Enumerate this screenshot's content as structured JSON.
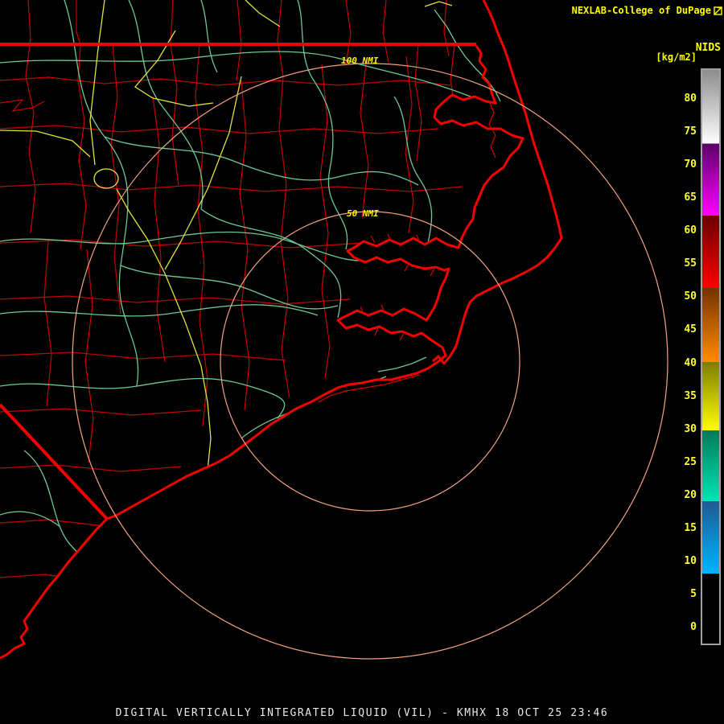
{
  "header": {
    "title": "NEXLAB-College of DuPage",
    "product_label": "NIDS",
    "units_label": "[kg/m2]"
  },
  "colorbar": {
    "border_color": "#a0a0a0",
    "tick_color": "#ffff2a",
    "tick_labels": [
      "80",
      "75",
      "70",
      "65",
      "60",
      "55",
      "50",
      "45",
      "40",
      "35",
      "30",
      "25",
      "20",
      "15",
      "10",
      "5",
      "0"
    ],
    "segments": [
      {
        "span": [
          0,
          0.128
        ],
        "from": "#8c8c8c",
        "to": "#ffffff"
      },
      {
        "span": [
          0.128,
          0.254
        ],
        "from": "#5a0068",
        "to": "#ff00ff"
      },
      {
        "span": [
          0.254,
          0.38
        ],
        "from": "#680000",
        "to": "#ff0000"
      },
      {
        "span": [
          0.38,
          0.509
        ],
        "from": "#743200",
        "to": "#ff8c00"
      },
      {
        "span": [
          0.509,
          0.628
        ],
        "from": "#7c7c00",
        "to": "#ffff00"
      },
      {
        "span": [
          0.628,
          0.752
        ],
        "from": "#00795a",
        "to": "#00e6b4"
      },
      {
        "span": [
          0.752,
          0.878
        ],
        "from": "#1e5a92",
        "to": "#00b4ff"
      },
      {
        "span": [
          0.878,
          1
        ],
        "from": "#000000",
        "to": "#000000"
      }
    ]
  },
  "map": {
    "range_ring_labels": {
      "outer": "100 NMI",
      "inner": "50 NMI"
    },
    "colors": {
      "state_border": "#f40000",
      "county": "#c80000",
      "coast": "#f40000",
      "estuary_detail": "#d40000",
      "road": "#6cc896",
      "highway": "#e2e23c",
      "ring": "#f4a480",
      "ring_label": "#ffef00",
      "logo": "#ffff00"
    }
  },
  "footer": {
    "caption": "DIGITAL VERTICALLY INTEGRATED LIQUID (VIL) - KMHX 18 OCT 25 23:46"
  }
}
